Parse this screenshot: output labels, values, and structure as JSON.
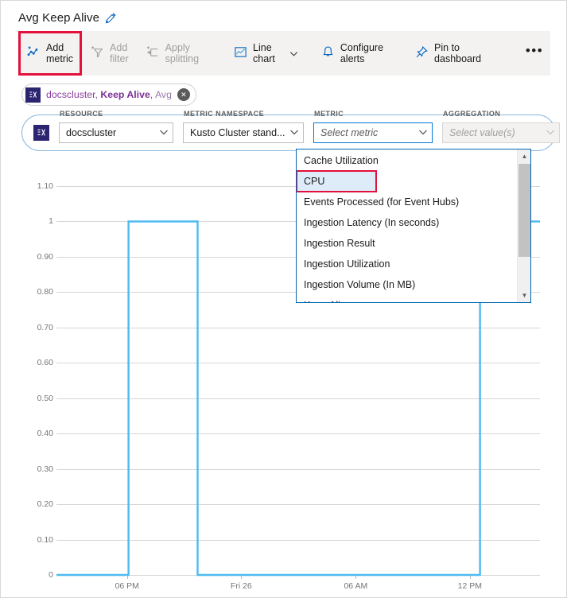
{
  "header": {
    "title": "Avg Keep Alive",
    "edit_icon": "pencil-icon"
  },
  "toolbar": {
    "items": [
      {
        "label_line1": "Add",
        "label_line2": "metric",
        "icon": "add-metric-icon",
        "disabled": false,
        "highlighted": true
      },
      {
        "label_line1": "Add",
        "label_line2": "filter",
        "icon": "add-filter-icon",
        "disabled": true,
        "highlighted": false
      },
      {
        "label_line1": "Apply",
        "label_line2": "splitting",
        "icon": "apply-splitting-icon",
        "disabled": true,
        "highlighted": false
      },
      {
        "label_line1": "Line",
        "label_line2": "chart",
        "icon": "line-chart-icon",
        "disabled": false,
        "highlighted": false
      },
      {
        "label_line1": "Configure",
        "label_line2": "alerts",
        "icon": "bell-icon",
        "disabled": false,
        "highlighted": false
      },
      {
        "label_line1": "Pin to",
        "label_line2": "dashboard",
        "icon": "pin-icon",
        "disabled": false,
        "highlighted": false
      }
    ],
    "chart_type_caret": "chevron-down-icon",
    "overflow": "•••"
  },
  "metric_chip": {
    "badge_icon": "metric-badge-icon",
    "resource": "docscluster",
    "separator1": ", ",
    "metric": "Keep Alive",
    "separator2": ", ",
    "aggregation": "Avg",
    "close_icon": "close-icon"
  },
  "metric_editor": {
    "badge_icon": "metric-badge-icon",
    "close_icon": "close-icon",
    "fields": [
      {
        "label": "RESOURCE",
        "value": "docscluster",
        "placeholder": false,
        "disabled": false,
        "active": false
      },
      {
        "label": "METRIC NAMESPACE",
        "value": "Kusto Cluster stand...",
        "placeholder": false,
        "disabled": false,
        "active": false
      },
      {
        "label": "METRIC",
        "value": "Select metric",
        "placeholder": true,
        "disabled": false,
        "active": true
      },
      {
        "label": "AGGREGATION",
        "value": "Select value(s)",
        "placeholder": true,
        "disabled": true,
        "active": false
      }
    ]
  },
  "metric_dropdown": {
    "options": [
      {
        "label": "Cache Utilization",
        "selected": false,
        "outlined": false
      },
      {
        "label": "CPU",
        "selected": true,
        "outlined": true
      },
      {
        "label": "Events Processed (for Event Hubs)",
        "selected": false,
        "outlined": false
      },
      {
        "label": "Ingestion Latency (In seconds)",
        "selected": false,
        "outlined": false
      },
      {
        "label": "Ingestion Result",
        "selected": false,
        "outlined": false
      },
      {
        "label": "Ingestion Utilization",
        "selected": false,
        "outlined": false
      },
      {
        "label": "Ingestion Volume (In MB)",
        "selected": false,
        "outlined": false
      },
      {
        "label": "Keep Alive",
        "selected": false,
        "outlined": false
      }
    ],
    "scroll_up_icon": "triangle-up-icon",
    "scroll_down_icon": "triangle-down-icon"
  },
  "colors": {
    "accent": "#0078d4",
    "series": "#4ebaf0",
    "highlight": "#e3103c",
    "toolbar_bg": "#f3f2f1",
    "badge": "#2b2471",
    "chip_text": "#8a3fa0",
    "gridline": "#d6d6d6"
  },
  "chart_data": {
    "type": "line",
    "title": "Avg Keep Alive",
    "xlabel": "",
    "ylabel": "",
    "ylim": [
      0,
      1.1
    ],
    "yticks": [
      "0",
      "0.10",
      "0.20",
      "0.30",
      "0.40",
      "0.50",
      "0.60",
      "0.70",
      "0.80",
      "0.90",
      "1",
      "1.10"
    ],
    "ytick_values": [
      0,
      0.1,
      0.2,
      0.3,
      0.4,
      0.5,
      0.6,
      0.7,
      0.8,
      0.9,
      1.0,
      1.1
    ],
    "xticks": [
      "06 PM",
      "Fri 26",
      "06 AM",
      "12 PM"
    ],
    "xtick_positions": [
      0.146,
      0.382,
      0.619,
      0.855
    ],
    "grid": true,
    "legend": false,
    "series": [
      {
        "name": "Avg Keep Alive",
        "color": "#4ebaf0",
        "step": true,
        "points": [
          {
            "x": 0.0,
            "y": 0
          },
          {
            "x": 0.149,
            "y": 0
          },
          {
            "x": 0.149,
            "y": 1
          },
          {
            "x": 0.292,
            "y": 1
          },
          {
            "x": 0.292,
            "y": 0
          },
          {
            "x": 0.876,
            "y": 0
          },
          {
            "x": 0.876,
            "y": 1
          },
          {
            "x": 1.0,
            "y": 1
          }
        ]
      }
    ]
  }
}
